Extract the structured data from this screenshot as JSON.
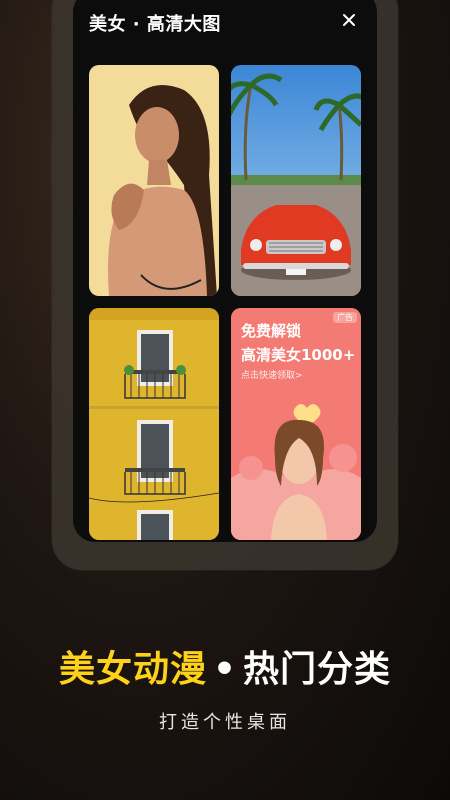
{
  "header": {
    "title": "美女 · 高清大图",
    "close_icon": "close-icon"
  },
  "gallery": {
    "items": [
      {
        "name": "portrait-photo",
        "icon": "woman-portrait"
      },
      {
        "name": "vintage-car-photo",
        "icon": "red-car-palm-trees"
      },
      {
        "name": "building-photo",
        "icon": "yellow-building-windows"
      }
    ],
    "promo": {
      "line1": "免费解锁",
      "line2": "高清美女1000+",
      "link": "点击快速领取>",
      "badge": "广告"
    }
  },
  "headline": {
    "highlight": "美女动漫",
    "separator": "•",
    "rest": "热门分类"
  },
  "subtitle": "打造个性桌面",
  "colors": {
    "accent": "#ffd21a",
    "promo_bg": "#f36f6c",
    "background": "#1e1612"
  }
}
